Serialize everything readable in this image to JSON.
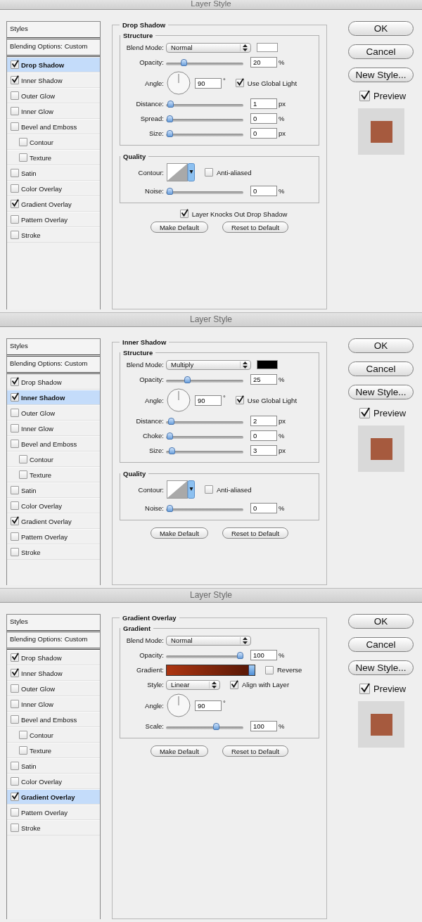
{
  "dialogs": [
    {
      "title": "Layer Style",
      "list_headers": [
        {
          "label": "Styles",
          "selected": false
        },
        {
          "label": "Blending Options: Custom",
          "selected": false
        }
      ],
      "style_items": [
        {
          "label": "Drop Shadow",
          "checked": true,
          "selected": true
        },
        {
          "label": "Inner Shadow",
          "checked": true,
          "selected": false
        },
        {
          "label": "Outer Glow",
          "checked": false,
          "selected": false
        },
        {
          "label": "Inner Glow",
          "checked": false,
          "selected": false
        },
        {
          "label": "Bevel and Emboss",
          "checked": false,
          "selected": false,
          "children": [
            {
              "label": "Contour",
              "checked": false,
              "selected": false
            },
            {
              "label": "Texture",
              "checked": false,
              "selected": false
            }
          ]
        },
        {
          "label": "Satin",
          "checked": false,
          "selected": false
        },
        {
          "label": "Color Overlay",
          "checked": false,
          "selected": false
        },
        {
          "label": "Gradient Overlay",
          "checked": true,
          "selected": false
        },
        {
          "label": "Pattern Overlay",
          "checked": false,
          "selected": false
        },
        {
          "label": "Stroke",
          "checked": false,
          "selected": false
        }
      ],
      "section_title": "Drop Shadow",
      "groups": [
        {
          "title": "Structure",
          "rows": [
            {
              "kind": "select",
              "label": "Blend Mode:",
              "value": "Normal",
              "color": "#ffffff"
            },
            {
              "kind": "slider",
              "label": "Opacity:",
              "level": 0.2,
              "value": "20",
              "unit": "%"
            },
            {
              "kind": "angle",
              "label": "Angle:",
              "value": "90",
              "unit": "°",
              "option": {
                "label": "Use Global Light",
                "checked": true
              }
            },
            {
              "kind": "slider",
              "label": "Distance:",
              "level": 0.01,
              "value": "1",
              "unit": "px"
            },
            {
              "kind": "slider",
              "label": "Spread:",
              "level": 0,
              "value": "0",
              "unit": "%"
            },
            {
              "kind": "slider",
              "label": "Size:",
              "level": 0,
              "value": "0",
              "unit": "px"
            }
          ]
        },
        {
          "title": "Quality",
          "rows": [
            {
              "kind": "contour",
              "label": "Contour:",
              "option": {
                "label": "Anti-aliased",
                "checked": false
              }
            },
            {
              "kind": "slider",
              "label": "Noise:",
              "level": 0,
              "value": "0",
              "unit": "%"
            }
          ]
        }
      ],
      "footer_option": {
        "label": "Layer Knocks Out Drop Shadow",
        "checked": true
      },
      "footer_buttons": [
        "Make Default",
        "Reset to Default"
      ],
      "buttons": [
        "OK",
        "Cancel",
        "New Style..."
      ],
      "preview": {
        "label": "Preview",
        "checked": true,
        "color": "#a65a3e"
      }
    },
    {
      "title": "Layer Style",
      "list_headers": [
        {
          "label": "Styles",
          "selected": false
        },
        {
          "label": "Blending Options: Custom",
          "selected": false
        }
      ],
      "style_items": [
        {
          "label": "Drop Shadow",
          "checked": true,
          "selected": false
        },
        {
          "label": "Inner Shadow",
          "checked": true,
          "selected": true
        },
        {
          "label": "Outer Glow",
          "checked": false,
          "selected": false
        },
        {
          "label": "Inner Glow",
          "checked": false,
          "selected": false
        },
        {
          "label": "Bevel and Emboss",
          "checked": false,
          "selected": false,
          "children": [
            {
              "label": "Contour",
              "checked": false,
              "selected": false
            },
            {
              "label": "Texture",
              "checked": false,
              "selected": false
            }
          ]
        },
        {
          "label": "Satin",
          "checked": false,
          "selected": false
        },
        {
          "label": "Color Overlay",
          "checked": false,
          "selected": false
        },
        {
          "label": "Gradient Overlay",
          "checked": true,
          "selected": false
        },
        {
          "label": "Pattern Overlay",
          "checked": false,
          "selected": false
        },
        {
          "label": "Stroke",
          "checked": false,
          "selected": false
        }
      ],
      "section_title": "Inner Shadow",
      "groups": [
        {
          "title": "Structure",
          "rows": [
            {
              "kind": "select",
              "label": "Blend Mode:",
              "value": "Multiply",
              "color": "#000000"
            },
            {
              "kind": "slider",
              "label": "Opacity:",
              "level": 0.25,
              "value": "25",
              "unit": "%"
            },
            {
              "kind": "angle",
              "label": "Angle:",
              "value": "90",
              "unit": "°",
              "option": {
                "label": "Use Global Light",
                "checked": true
              }
            },
            {
              "kind": "slider",
              "label": "Distance:",
              "level": 0.02,
              "value": "2",
              "unit": "px"
            },
            {
              "kind": "slider",
              "label": "Choke:",
              "level": 0,
              "value": "0",
              "unit": "%"
            },
            {
              "kind": "slider",
              "label": "Size:",
              "level": 0.03,
              "value": "3",
              "unit": "px"
            }
          ]
        },
        {
          "title": "Quality",
          "rows": [
            {
              "kind": "contour",
              "label": "Contour:",
              "option": {
                "label": "Anti-aliased",
                "checked": false
              }
            },
            {
              "kind": "slider",
              "label": "Noise:",
              "level": 0,
              "value": "0",
              "unit": "%"
            }
          ]
        }
      ],
      "footer_buttons": [
        "Make Default",
        "Reset to Default"
      ],
      "buttons": [
        "OK",
        "Cancel",
        "New Style..."
      ],
      "preview": {
        "label": "Preview",
        "checked": true,
        "color": "#a65a3e"
      }
    },
    {
      "title": "Layer Style",
      "list_headers": [
        {
          "label": "Styles",
          "selected": false
        },
        {
          "label": "Blending Options: Custom",
          "selected": false
        }
      ],
      "style_items": [
        {
          "label": "Drop Shadow",
          "checked": true,
          "selected": false
        },
        {
          "label": "Inner Shadow",
          "checked": true,
          "selected": false
        },
        {
          "label": "Outer Glow",
          "checked": false,
          "selected": false
        },
        {
          "label": "Inner Glow",
          "checked": false,
          "selected": false
        },
        {
          "label": "Bevel and Emboss",
          "checked": false,
          "selected": false,
          "children": [
            {
              "label": "Contour",
              "checked": false,
              "selected": false
            },
            {
              "label": "Texture",
              "checked": false,
              "selected": false
            }
          ]
        },
        {
          "label": "Satin",
          "checked": false,
          "selected": false
        },
        {
          "label": "Color Overlay",
          "checked": false,
          "selected": false
        },
        {
          "label": "Gradient Overlay",
          "checked": true,
          "selected": true
        },
        {
          "label": "Pattern Overlay",
          "checked": false,
          "selected": false
        },
        {
          "label": "Stroke",
          "checked": false,
          "selected": false
        }
      ],
      "section_title": "Gradient Overlay",
      "groups": [
        {
          "title": "Gradient",
          "rows": [
            {
              "kind": "select",
              "label": "Blend Mode:",
              "value": "Normal"
            },
            {
              "kind": "slider",
              "label": "Opacity:",
              "level": 1,
              "value": "100",
              "unit": "%"
            },
            {
              "kind": "gradient",
              "label": "Gradient:",
              "stops": [
                {
                  "color": "#a93411"
                },
                {
                  "color": "#5e1a07"
                }
              ],
              "option": {
                "label": "Reverse",
                "checked": false
              }
            },
            {
              "kind": "small_select",
              "label": "Style:",
              "value": "Linear",
              "option": {
                "label": "Align with Layer",
                "checked": true
              }
            },
            {
              "kind": "angle",
              "label": "Angle:",
              "value": "90",
              "unit": "°"
            },
            {
              "kind": "slider",
              "label": "Scale:",
              "level": 0.66,
              "value": "100",
              "unit": "%"
            }
          ]
        }
      ],
      "footer_buttons": [
        "Make Default",
        "Reset to Default"
      ],
      "buttons": [
        "OK",
        "Cancel",
        "New Style..."
      ],
      "preview": {
        "label": "Preview",
        "checked": true,
        "color": "#a65a3e"
      }
    }
  ]
}
